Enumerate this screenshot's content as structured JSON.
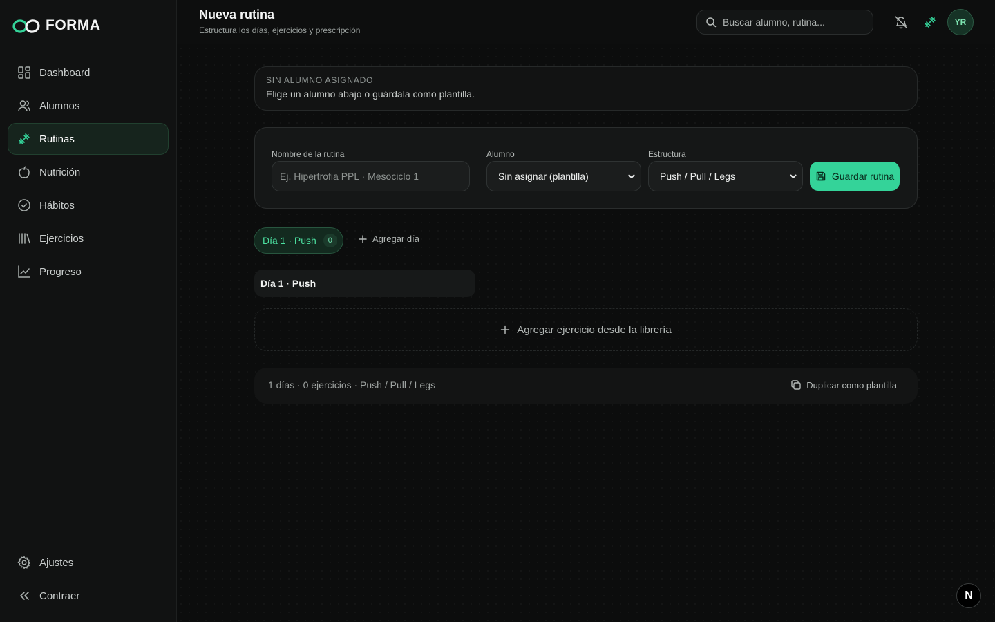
{
  "app": {
    "name": "FORMA"
  },
  "colors": {
    "accent": "#34d399",
    "background": "#0b0c0c",
    "sidebar": "#111212"
  },
  "sidebar": {
    "items": [
      {
        "label": "Dashboard",
        "icon": "grid-icon"
      },
      {
        "label": "Alumnos",
        "icon": "users-icon"
      },
      {
        "label": "Rutinas",
        "icon": "dumbbell-icon",
        "active": true
      },
      {
        "label": "Nutrición",
        "icon": "apple-icon"
      },
      {
        "label": "Hábitos",
        "icon": "check-circle-icon"
      },
      {
        "label": "Ejercicios",
        "icon": "library-icon"
      },
      {
        "label": "Progreso",
        "icon": "chart-icon"
      }
    ],
    "bottom": [
      {
        "label": "Ajustes",
        "icon": "gear-icon"
      },
      {
        "label": "Contraer",
        "icon": "chevrons-left-icon"
      }
    ]
  },
  "header": {
    "title": "Nueva rutina",
    "subtitle": "Estructura los días, ejercicios y prescripción",
    "search_placeholder": "Buscar alumno, rutina...",
    "avatar_initials": "YR"
  },
  "notice": {
    "title": "SIN ALUMNO ASIGNADO",
    "text": "Elige un alumno abajo o guárdala como plantilla."
  },
  "form": {
    "name_label": "Nombre de la rutina",
    "name_placeholder": "Ej. Hipertrofia PPL · Mesociclo 1",
    "name_value": "",
    "student_label": "Alumno",
    "student_value": "Sin asignar (plantilla)",
    "structure_label": "Estructura",
    "structure_value": "Push / Pull / Legs",
    "save_label": "Guardar rutina"
  },
  "days": {
    "tabs": [
      {
        "label": "Día 1 · Push",
        "count": "0"
      }
    ],
    "add_day_label": "Agregar día",
    "current_day_name": "Día 1 · Push",
    "add_exercise_label": "Agregar ejercicio desde la librería"
  },
  "summary": {
    "text": "1 días · 0 ejercicios · Push / Pull / Legs",
    "duplicate_label": "Duplicar como plantilla"
  },
  "badge": {
    "letter": "N"
  }
}
